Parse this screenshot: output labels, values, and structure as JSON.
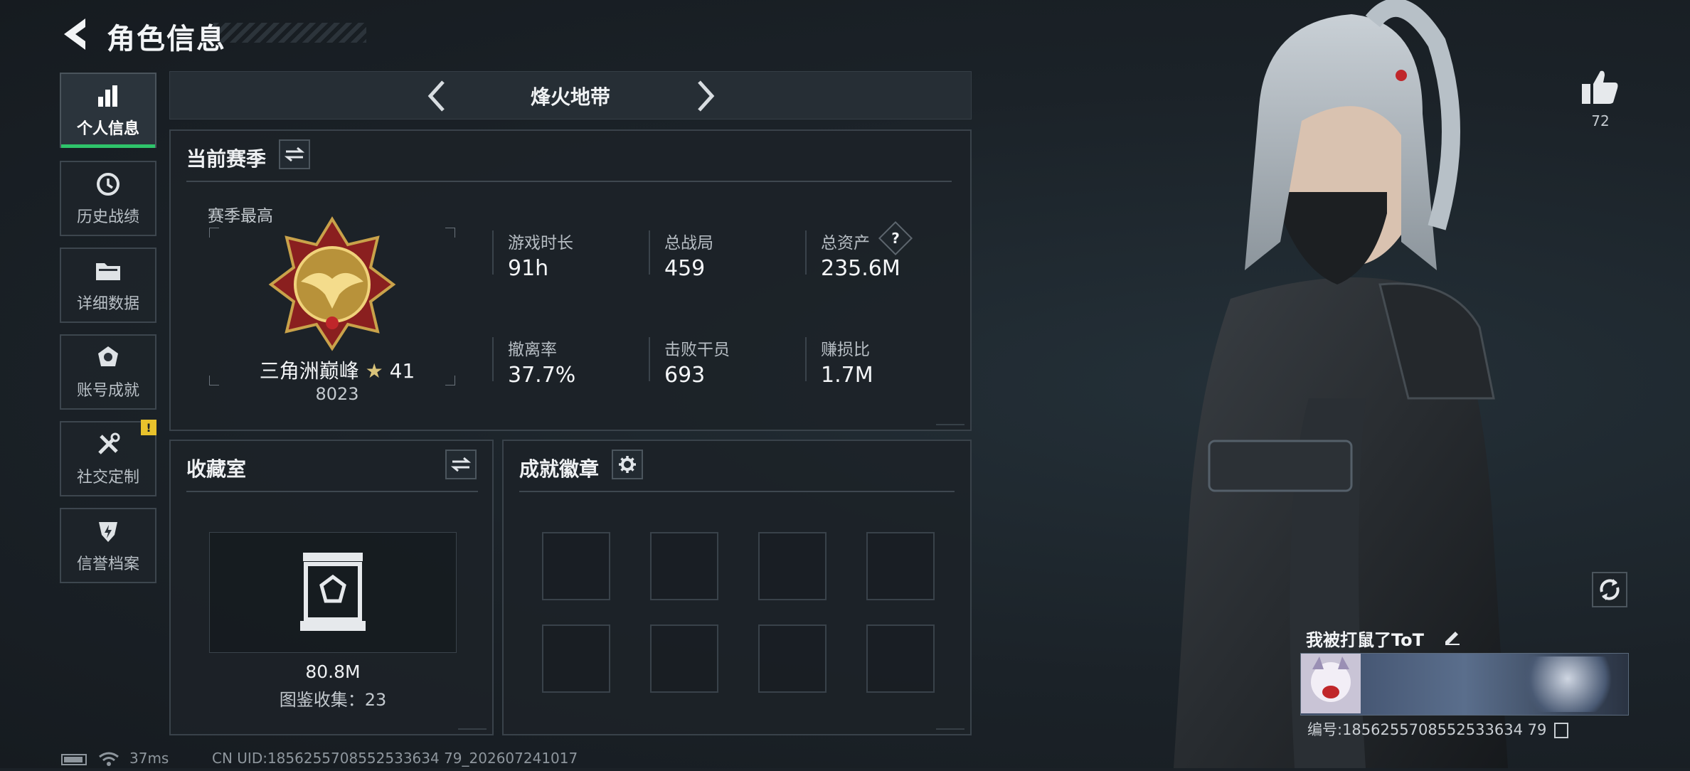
{
  "header": {
    "title": "角色信息"
  },
  "nav": [
    {
      "label": "个人信息",
      "icon": "bar-chart-icon",
      "active": true
    },
    {
      "label": "历史战绩",
      "icon": "history-clock-icon"
    },
    {
      "label": "详细数据",
      "icon": "folder-icon"
    },
    {
      "label": "账号成就",
      "icon": "achievement-icon"
    },
    {
      "label": "社交定制",
      "icon": "tools-icon",
      "badge": "!"
    },
    {
      "label": "信誉档案",
      "icon": "shield-bolt-icon"
    }
  ],
  "mode": {
    "title": "烽火地带"
  },
  "season": {
    "title": "当前赛季",
    "best_label": "赛季最高",
    "rank_name": "三角洲巅峰",
    "rank_stars": "41",
    "rank_score": "8023",
    "stats": [
      {
        "label": "游戏时长",
        "value": "91h"
      },
      {
        "label": "总战局",
        "value": "459"
      },
      {
        "label": "总资产",
        "value": "235.6M",
        "help": "?"
      },
      {
        "label": "撤离率",
        "value": "37.7%"
      },
      {
        "label": "击败干员",
        "value": "693"
      },
      {
        "label": "赚损比",
        "value": "1.7M"
      }
    ]
  },
  "collection": {
    "title": "收藏室",
    "value": "80.8M",
    "catalog": "图鉴收集：23"
  },
  "badges": {
    "title": "成就徽章",
    "slots": 8
  },
  "player": {
    "likes": "72",
    "name": "我被打鼠了ToT",
    "id_text": "编号:1856255708552533634 79"
  },
  "footer": {
    "ping": "37ms",
    "uid": "CN UID:1856255708552533634 79_202607241017"
  },
  "colors": {
    "accent_green": "#2fc46b",
    "badge_yellow": "#e8c22c",
    "panel_border": "#39424a"
  }
}
